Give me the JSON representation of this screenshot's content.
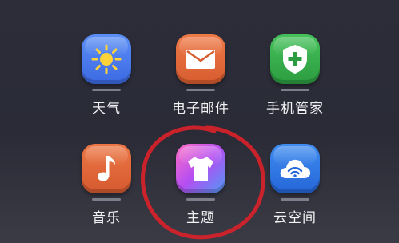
{
  "apps": [
    {
      "label": "天气",
      "icon": "sun-icon",
      "color": "#4a7df0"
    },
    {
      "label": "电子邮件",
      "icon": "envelope-icon",
      "color": "#e56b3c"
    },
    {
      "label": "手机管家",
      "icon": "shield-plus-icon",
      "color": "#36b04a"
    },
    {
      "label": "音乐",
      "icon": "music-note-icon",
      "color": "#e3683b"
    },
    {
      "label": "主题",
      "icon": "tshirt-icon",
      "color": "#b94ff0"
    },
    {
      "label": "云空间",
      "icon": "cloud-wifi-icon",
      "color": "#2f7de8"
    }
  ],
  "annotation": {
    "type": "hand-drawn circle",
    "color": "#d8222a"
  }
}
